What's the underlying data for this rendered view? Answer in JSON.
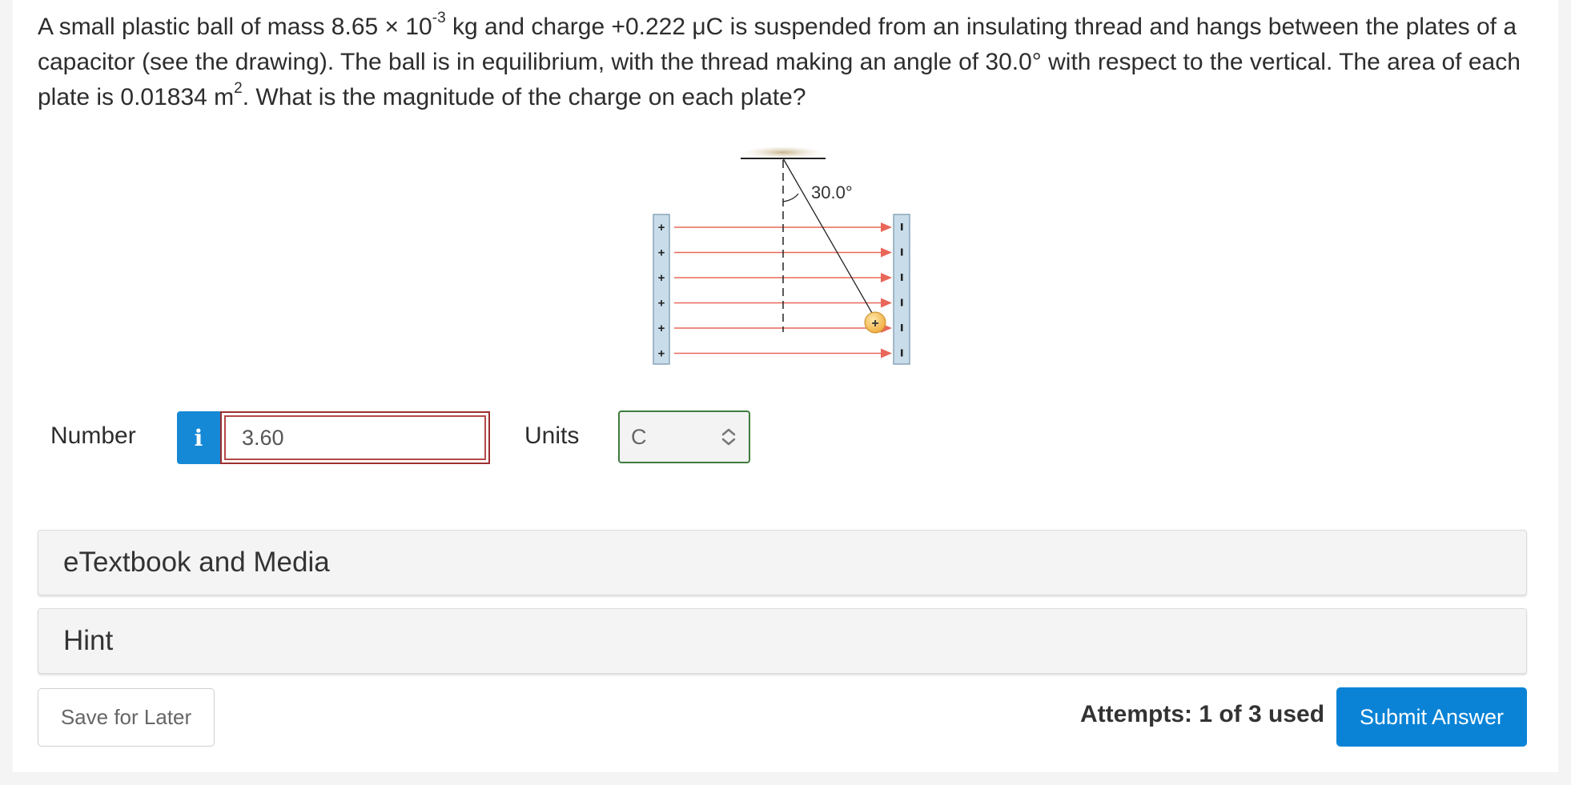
{
  "question": {
    "part1": "A small plastic ball of mass 8.65 × 10",
    "exp1": "-3",
    "part2": " kg and charge +0.222 μC is suspended from an insulating thread and hangs between the plates of a capacitor (see the drawing). The ball is in equilibrium, with the thread making an angle of 30.0° with respect to the vertical. The area of each plate is 0.01834 m",
    "exp2": "2",
    "part3": ". What is the magnitude of the charge on each plate?"
  },
  "diagram": {
    "angle_label": "30.0°",
    "plus_sign": "+",
    "minus_sign": "–",
    "ball_label": "+"
  },
  "answer": {
    "number_label": "Number",
    "info_icon_glyph": "i",
    "number_value": "3.60",
    "units_label": "Units",
    "units_value": "C"
  },
  "panels": {
    "etextbook": "eTextbook and Media",
    "hint": "Hint"
  },
  "footer": {
    "save_label": "Save for Later",
    "attempts": "Attempts: 1 of 3 used",
    "submit_label": "Submit Answer"
  },
  "colors": {
    "accent": "#0a83d6",
    "field_line": "#e9685a",
    "error_border": "#9d2f2f"
  }
}
